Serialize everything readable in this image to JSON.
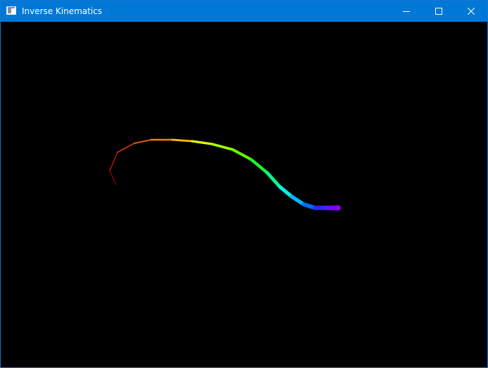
{
  "window": {
    "title": "Inverse Kinematics",
    "icons": {
      "app": "app-window-icon",
      "minimize": "minimize-icon",
      "maximize": "maximize-icon",
      "close": "close-icon"
    },
    "colors": {
      "titlebar": "#0078d7",
      "canvas_background": "#000000"
    }
  },
  "scene": {
    "segment_colors": [
      "#b30000",
      "#c21800",
      "#d13600",
      "#e05a00",
      "#ef8300",
      "#ffc000",
      "#e5ff00",
      "#a7ff00",
      "#61ff00",
      "#1aff28",
      "#00ff8a",
      "#00f5e6",
      "#00b7ff",
      "#006cff",
      "#2a28ff",
      "#5a18ff",
      "#7500ff",
      "#8c00ff"
    ]
  }
}
